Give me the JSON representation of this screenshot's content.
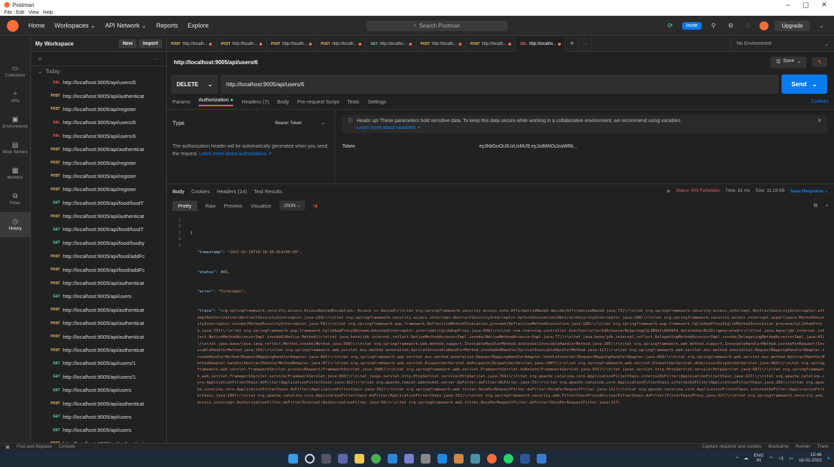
{
  "window": {
    "title": "Postman",
    "menu": [
      "File",
      "Edit",
      "View",
      "Help"
    ],
    "controls": [
      "–",
      "▢",
      "✕"
    ]
  },
  "header": {
    "nav": [
      "Home",
      "Workspaces ⌄",
      "API Network ⌄",
      "Reports",
      "Explore"
    ],
    "search": "Search Postman",
    "invite": "Invite",
    "upgrade": "Upgrade"
  },
  "rail": [
    {
      "label": "Collections",
      "icon": "▭"
    },
    {
      "label": "APIs",
      "icon": "⚬"
    },
    {
      "label": "Environments",
      "icon": "▣"
    },
    {
      "label": "Mock Servers",
      "icon": "▤"
    },
    {
      "label": "Monitors",
      "icon": "▦"
    },
    {
      "label": "Flows",
      "icon": "⧉"
    },
    {
      "label": "History",
      "icon": "◷"
    }
  ],
  "sidebar": {
    "workspace": "My Workspace",
    "new_label": "New",
    "import_label": "Import",
    "group": "Today",
    "items": [
      {
        "m": "DEL",
        "u": "http://localhost:9005/api/users/6"
      },
      {
        "m": "POST",
        "u": "http://localhost:9005/api/authenticat"
      },
      {
        "m": "POST",
        "u": "http://localhost:9005/api/register"
      },
      {
        "m": "DEL",
        "u": "http://localhost:9005/api/users/6"
      },
      {
        "m": "DEL",
        "u": "http://localhost:9005/api/users/6"
      },
      {
        "m": "POST",
        "u": "http://localhost:9005/api/authenticat"
      },
      {
        "m": "POST",
        "u": "http://localhost:9005/api/register"
      },
      {
        "m": "POST",
        "u": "http://localhost:9005/api/register"
      },
      {
        "m": "POST",
        "u": "http://localhost:9005/api/register"
      },
      {
        "m": "GET",
        "u": "http://localhost:9005/api/food/foodT"
      },
      {
        "m": "POST",
        "u": "http://localhost:9005/api/authenticat"
      },
      {
        "m": "GET",
        "u": "http://localhost:9005/api/food/foodT"
      },
      {
        "m": "GET",
        "u": "http://localhost:9005/api/food/foodty"
      },
      {
        "m": "POST",
        "u": "http://localhost:9005/api/food/addFc"
      },
      {
        "m": "POST",
        "u": "http://localhost:9005/api/food/addFc"
      },
      {
        "m": "POST",
        "u": "http://localhost:9005/api/authenticat"
      },
      {
        "m": "GET",
        "u": "http://localhost:9005/api/users"
      },
      {
        "m": "POST",
        "u": "http://localhost:9005/api/authenticat"
      },
      {
        "m": "POST",
        "u": "http://localhost:9005/api/authenticat"
      },
      {
        "m": "POST",
        "u": "http://localhost:9005/api/authenticat"
      },
      {
        "m": "POST",
        "u": "http://localhost:9005/api/authenticat"
      },
      {
        "m": "GET",
        "u": "http://localhost:9005/api/users/1"
      },
      {
        "m": "GET",
        "u": "http://localhost:9005/api/users/1"
      },
      {
        "m": "GET",
        "u": "http://localhost:9005/api/users"
      },
      {
        "m": "POST",
        "u": "http://localhost:9005/api/authenticat"
      },
      {
        "m": "GET",
        "u": "http://localhost:9005/api/users"
      },
      {
        "m": "GET",
        "u": "http://localhost:9005/api/users"
      },
      {
        "m": "POST",
        "u": "http://localhost:9005/api/authenticat"
      },
      {
        "m": "POST",
        "u": "http://localhost:9005/api/register"
      }
    ]
  },
  "tabs": [
    {
      "m": "POST",
      "u": "http://localh..."
    },
    {
      "m": "POST",
      "u": "http://localh..."
    },
    {
      "m": "POST",
      "u": "http://localh..."
    },
    {
      "m": "POST",
      "u": "http://localh..."
    },
    {
      "m": "GET",
      "u": "http://localho..."
    },
    {
      "m": "POST",
      "u": "http://localh..."
    },
    {
      "m": "POST",
      "u": "http://localh..."
    },
    {
      "m": "DEL",
      "u": "http://localho..."
    }
  ],
  "environment": "No Environment",
  "request": {
    "title": "http://localhost:9005/api/users/6",
    "method": "DELETE",
    "url": "http://localhost:9005/api/users/6",
    "save": "Save",
    "send": "Send",
    "subtabs": [
      "Params",
      "Authorization",
      "Headers (7)",
      "Body",
      "Pre-request Script",
      "Tests",
      "Settings"
    ],
    "cookies": "Cookies"
  },
  "auth": {
    "type_label": "Type",
    "type_value": "Bearer Token",
    "desc": "The authorization header will be automatically generated when you send the request.",
    "learn": "Learn more about authorization ↗",
    "info": "Heads up! These parameters hold sensitive data. To keep this data secure while working in a collaborative environment, we recommend using variables.",
    "info_link": "Learn more about variables ↗",
    "token_label": "Token",
    "token_value": "eyJhbGciOiJIUzUxMiJ9.eyJzdWliOiJzaWRk..."
  },
  "response": {
    "tabs": [
      "Body",
      "Cookies",
      "Headers (14)",
      "Test Results"
    ],
    "status": "Status: 403 Forbidden",
    "time": "Time: 81 ms",
    "size": "Size: 11.19 KB",
    "save": "Save Response ⌄",
    "views": [
      "Pretty",
      "Raw",
      "Preview",
      "Visualize"
    ],
    "format": "JSON ⌄",
    "lines": [
      "1",
      "2",
      "3",
      "4",
      "5"
    ],
    "timestamp": "\"2022-02-18T10:16:36.814+00:00\",",
    "status_val": "403,",
    "error_val": "\"Forbidden\",",
    "trace": "\"org.springframework.security.access.AccessDeniedException: Access is denied\\r\\n\\tat org.springframework.security.access.vote.AffirmativeBased.decide(AffirmativeBased.java:73)\\r\\n\\tat org.springframework.security.access.intercept.AbstractSecurityInterceptor.attemptAuthorization(AbstractSecurityInterceptor.java:239)\\r\\n\\tat org.springframework.security.access.intercept.AbstractSecurityInterceptor.beforeInvocation(AbstractSecurityInterceptor.java:208)\\r\\n\\tat org.springframework.security.access.intercept.aopalliance.MethodSecurityInterceptor.invoke(MethodSecurityInterceptor.java:58)\\r\\n\\tat org.springframework.aop.framework.ReflectiveMethodInvocation.proceed(ReflectiveMethodInvocation.java:186)\\r\\n\\tat org.springframework.aop.framework.CglibAopProxy$CglibMethodInvocation.proceed(CglibAopProxy.java:753)\\r\\n\\tat org.springframework.aop.framework.CglibAopProxy$DynamicAdvisedInterceptor.intercept(CglibAopProxy.java:698)\\r\\n\\tat com.learning.controller.UserController$$EnhancerBySpringCGLIB$$fc044954.deleteUserByID(<generated>)\\r\\n\\tat java.base/jdk.internal.reflect.NativeMethodAccessorImpl.invoke0(Native Method)\\r\\n\\tat java.base/jdk.internal.reflect.NativeMethodAccessorImpl.invoke(NativeMethodAccessorImpl.java:77)\\r\\n\\tat java.base/jdk.internal.reflect.DelegatingMethodAccessorImpl.invoke(DelegatingMethodAccessorImpl.java:43)\\r\\n\\tat java.base/java.lang.reflect.Method.invoke(Method.java:568)\\r\\n\\tat org.springframework.web.method.support.InvocableHandlerMethod.doInvoke(InvocableHandlerMethod.java:205)\\r\\n\\tat org.springframework.web.method.support.InvocableHandlerMethod.invokeForRequest(InvocableHandlerMethod.java:150)\\r\\n\\tat org.springframework.web.servlet.mvc.method.annotation.ServletInvocableHandlerMethod.invokeAndHandle(ServletInvocableHandlerMethod.java:117)\\r\\n\\tat org.springframework.web.servlet.mvc.method.annotation.RequestMappingHandlerAdapter.invokeHandlerMethod(RequestMappingHandlerAdapter.java:895)\\r\\n\\tat org.springframework.web.servlet.mvc.method.annotation.RequestMappingHandlerAdapter.handleInternal(RequestMappingHandlerAdapter.java:808)\\r\\n\\tat org.springframework.web.servlet.mvc.method.AbstractHandlerMethodAdapter.handle(AbstractHandlerMethodAdapter.java:87)\\r\\n\\tat org.springframework.web.servlet.DispatcherServlet.doDispatch(DispatcherServlet.java:1067)\\r\\n\\tat org.springframework.web.servlet.DispatcherServlet.doService(DispatcherServlet.java:963)\\r\\n\\tat org.springframework.web.servlet.FrameworkServlet.processRequest(FrameworkServlet.java:1006)\\r\\n\\tat org.springframework.web.servlet.FrameworkServlet.doDelete(FrameworkServlet.java:931)\\r\\n\\tat javax.servlet.http.HttpServlet.service(HttpServlet.java:687)\\r\\n\\tat org.springframework.web.servlet.FrameworkServlet.service(FrameworkServlet.java:883)\\r\\n\\tat javax.servlet.http.HttpServlet.service(HttpServlet.java:764)\\r\\n\\tat org.apache.catalina.core.ApplicationFilterChain.internalDoFilter(ApplicationFilterChain.java:227)\\r\\n\\tat org.apache.catalina.core.ApplicationFilterChain.doFilter(ApplicationFilterChain.java:162)\\r\\n\\tat org.apache.tomcat.websocket.server.WsFilter.doFilter(WsFilter.java:53)\\r\\n\\tat org.apache.catalina.core.ApplicationFilterChain.internalDoFilter(ApplicationFilterChain.java:189)\\r\\n\\tat org.apache.catalina.core.ApplicationFilterChain.doFilter(ApplicationFilterChain.java:162)\\r\\n\\tat org.springframework.web.filter.OncePerRequestFilter.doFilter(OncePerRequestFilter.java:111)\\r\\n\\tat org.apache.catalina.core.ApplicationFilterChain.internalDoFilter(ApplicationFilterChain.java:189)\\r\\n\\tat org.apache.catalina.core.ApplicationFilterChain.doFilter(ApplicationFilterChain.java:162)\\r\\n\\tat org.springframework.security.web.FilterChainProxy$VirtualFilterChain.doFilter(FilterChainProxy.java:327)\\r\\n\\tat org.springframework.security.web.access.intercept.AuthorizationFilter.doFilterInternal(AuthorizationFilter.java:58)\\r\\n\\tat org.springframework.web.filter.OncePerRequestFilter.doFilter(OncePerRequestFilter.java:117)"
  },
  "statusbar": {
    "left": [
      "Find and Replace",
      "Console"
    ],
    "right": [
      "Capture requests and cookies",
      "Bootcamp",
      "Runner",
      "Trash"
    ]
  },
  "tray": {
    "lang": "ENG",
    "region": "IN",
    "time": "15:46",
    "date": "18-02-2022"
  }
}
